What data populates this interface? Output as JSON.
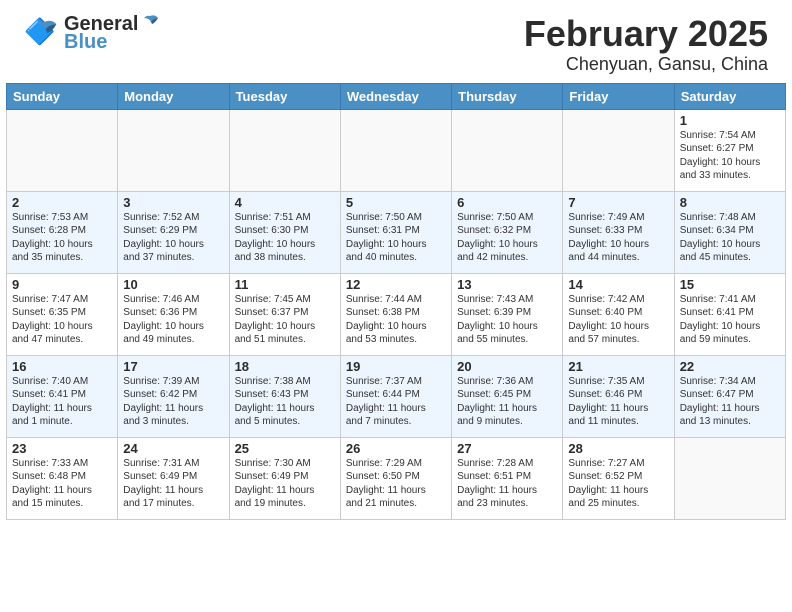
{
  "header": {
    "logo_general": "General",
    "logo_blue": "Blue",
    "month": "February 2025",
    "location": "Chenyuan, Gansu, China"
  },
  "weekdays": [
    "Sunday",
    "Monday",
    "Tuesday",
    "Wednesday",
    "Thursday",
    "Friday",
    "Saturday"
  ],
  "weeks": [
    [
      {
        "day": "",
        "info": ""
      },
      {
        "day": "",
        "info": ""
      },
      {
        "day": "",
        "info": ""
      },
      {
        "day": "",
        "info": ""
      },
      {
        "day": "",
        "info": ""
      },
      {
        "day": "",
        "info": ""
      },
      {
        "day": "1",
        "info": "Sunrise: 7:54 AM\nSunset: 6:27 PM\nDaylight: 10 hours\nand 33 minutes."
      }
    ],
    [
      {
        "day": "2",
        "info": "Sunrise: 7:53 AM\nSunset: 6:28 PM\nDaylight: 10 hours\nand 35 minutes."
      },
      {
        "day": "3",
        "info": "Sunrise: 7:52 AM\nSunset: 6:29 PM\nDaylight: 10 hours\nand 37 minutes."
      },
      {
        "day": "4",
        "info": "Sunrise: 7:51 AM\nSunset: 6:30 PM\nDaylight: 10 hours\nand 38 minutes."
      },
      {
        "day": "5",
        "info": "Sunrise: 7:50 AM\nSunset: 6:31 PM\nDaylight: 10 hours\nand 40 minutes."
      },
      {
        "day": "6",
        "info": "Sunrise: 7:50 AM\nSunset: 6:32 PM\nDaylight: 10 hours\nand 42 minutes."
      },
      {
        "day": "7",
        "info": "Sunrise: 7:49 AM\nSunset: 6:33 PM\nDaylight: 10 hours\nand 44 minutes."
      },
      {
        "day": "8",
        "info": "Sunrise: 7:48 AM\nSunset: 6:34 PM\nDaylight: 10 hours\nand 45 minutes."
      }
    ],
    [
      {
        "day": "9",
        "info": "Sunrise: 7:47 AM\nSunset: 6:35 PM\nDaylight: 10 hours\nand 47 minutes."
      },
      {
        "day": "10",
        "info": "Sunrise: 7:46 AM\nSunset: 6:36 PM\nDaylight: 10 hours\nand 49 minutes."
      },
      {
        "day": "11",
        "info": "Sunrise: 7:45 AM\nSunset: 6:37 PM\nDaylight: 10 hours\nand 51 minutes."
      },
      {
        "day": "12",
        "info": "Sunrise: 7:44 AM\nSunset: 6:38 PM\nDaylight: 10 hours\nand 53 minutes."
      },
      {
        "day": "13",
        "info": "Sunrise: 7:43 AM\nSunset: 6:39 PM\nDaylight: 10 hours\nand 55 minutes."
      },
      {
        "day": "14",
        "info": "Sunrise: 7:42 AM\nSunset: 6:40 PM\nDaylight: 10 hours\nand 57 minutes."
      },
      {
        "day": "15",
        "info": "Sunrise: 7:41 AM\nSunset: 6:41 PM\nDaylight: 10 hours\nand 59 minutes."
      }
    ],
    [
      {
        "day": "16",
        "info": "Sunrise: 7:40 AM\nSunset: 6:41 PM\nDaylight: 11 hours\nand 1 minute."
      },
      {
        "day": "17",
        "info": "Sunrise: 7:39 AM\nSunset: 6:42 PM\nDaylight: 11 hours\nand 3 minutes."
      },
      {
        "day": "18",
        "info": "Sunrise: 7:38 AM\nSunset: 6:43 PM\nDaylight: 11 hours\nand 5 minutes."
      },
      {
        "day": "19",
        "info": "Sunrise: 7:37 AM\nSunset: 6:44 PM\nDaylight: 11 hours\nand 7 minutes."
      },
      {
        "day": "20",
        "info": "Sunrise: 7:36 AM\nSunset: 6:45 PM\nDaylight: 11 hours\nand 9 minutes."
      },
      {
        "day": "21",
        "info": "Sunrise: 7:35 AM\nSunset: 6:46 PM\nDaylight: 11 hours\nand 11 minutes."
      },
      {
        "day": "22",
        "info": "Sunrise: 7:34 AM\nSunset: 6:47 PM\nDaylight: 11 hours\nand 13 minutes."
      }
    ],
    [
      {
        "day": "23",
        "info": "Sunrise: 7:33 AM\nSunset: 6:48 PM\nDaylight: 11 hours\nand 15 minutes."
      },
      {
        "day": "24",
        "info": "Sunrise: 7:31 AM\nSunset: 6:49 PM\nDaylight: 11 hours\nand 17 minutes."
      },
      {
        "day": "25",
        "info": "Sunrise: 7:30 AM\nSunset: 6:49 PM\nDaylight: 11 hours\nand 19 minutes."
      },
      {
        "day": "26",
        "info": "Sunrise: 7:29 AM\nSunset: 6:50 PM\nDaylight: 11 hours\nand 21 minutes."
      },
      {
        "day": "27",
        "info": "Sunrise: 7:28 AM\nSunset: 6:51 PM\nDaylight: 11 hours\nand 23 minutes."
      },
      {
        "day": "28",
        "info": "Sunrise: 7:27 AM\nSunset: 6:52 PM\nDaylight: 11 hours\nand 25 minutes."
      },
      {
        "day": "",
        "info": ""
      }
    ]
  ]
}
